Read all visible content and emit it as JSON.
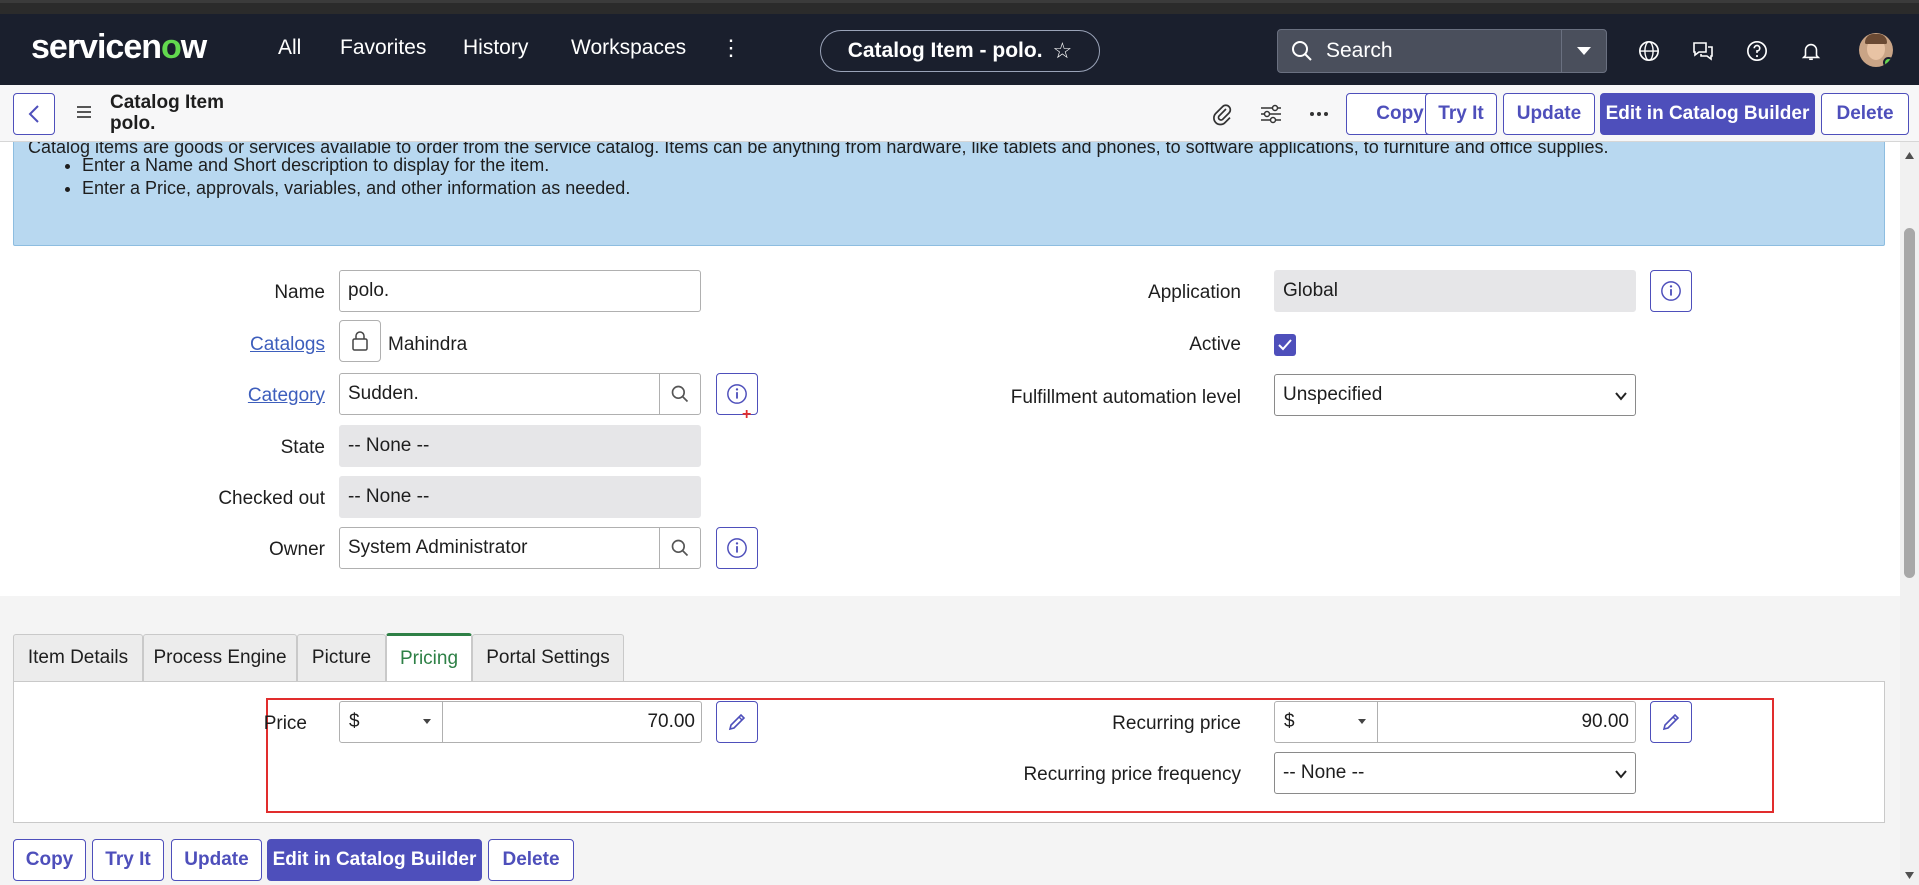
{
  "nav": {
    "logo_pre": "servicen",
    "logo_o": "o",
    "logo_post": "w",
    "links": [
      "All",
      "Favorites",
      "History",
      "Workspaces"
    ],
    "record_pill": "Catalog Item - polo.",
    "search_placeholder": "Search"
  },
  "header": {
    "title_line1": "Catalog Item",
    "title_line2": "polo.",
    "buttons": {
      "copy": "Copy",
      "try_it": "Try It",
      "update": "Update",
      "edit_builder": "Edit in Catalog Builder",
      "delete": "Delete"
    }
  },
  "banner": {
    "line0": "Catalog items are goods or services available to order from the service catalog. Items can be anything from hardware, like tablets and phones, to software applications, to furniture and office supplies.",
    "bullets": [
      "Enter a Name and Short description to display for the item.",
      "Enter a Price, approvals, variables, and other information as needed."
    ]
  },
  "form": {
    "name_label": "Name",
    "name_value": "polo.",
    "catalogs_label": "Catalogs",
    "catalogs_value": "Mahindra",
    "category_label": "Category",
    "category_value": "Sudden.",
    "state_label": "State",
    "state_value": "-- None --",
    "checked_out_label": "Checked out",
    "checked_out_value": "-- None --",
    "owner_label": "Owner",
    "owner_value": "System Administrator",
    "application_label": "Application",
    "application_value": "Global",
    "active_label": "Active",
    "active_checked": true,
    "fulfillment_label": "Fulfillment automation level",
    "fulfillment_value": "Unspecified"
  },
  "tabs": [
    "Item Details",
    "Process Engine",
    "Picture",
    "Pricing",
    "Portal Settings"
  ],
  "active_tab": "Pricing",
  "pricing": {
    "price_label": "Price",
    "price_currency": "$",
    "price_value": "70.00",
    "recurring_label": "Recurring price",
    "recurring_currency": "$",
    "recurring_value": "90.00",
    "frequency_label": "Recurring price frequency",
    "frequency_value": "-- None --"
  },
  "footer_buttons": {
    "copy": "Copy",
    "try_it": "Try It",
    "update": "Update",
    "edit_builder": "Edit in Catalog Builder",
    "delete": "Delete"
  },
  "colors": {
    "nav_bg": "#1a1f2d",
    "accent": "#4e4fbb",
    "banner_bg": "#b8d8f0",
    "active_tab": "#2e8046",
    "highlight": "#e12d2d"
  }
}
